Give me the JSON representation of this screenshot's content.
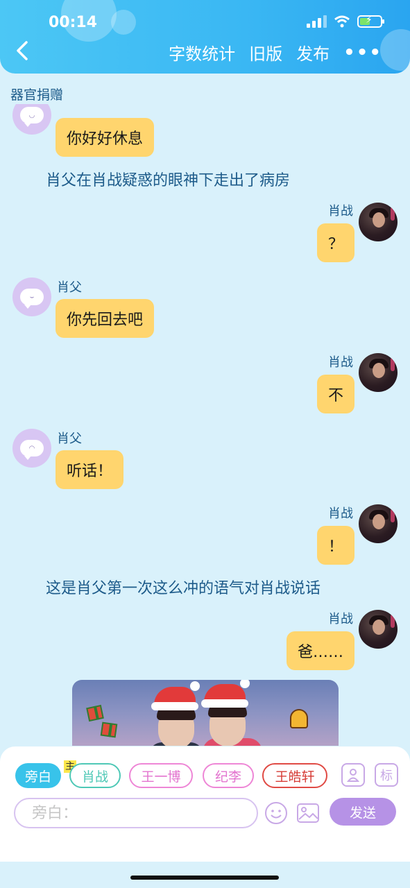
{
  "status": {
    "time": "00:14"
  },
  "header": {
    "back_icon": "chevron-left-icon",
    "actions": [
      "字数统计",
      "旧版",
      "发布"
    ],
    "more_label": "•••"
  },
  "subtitle": "器官捐赠",
  "colors": {
    "header": "#3ab7f3",
    "bubble": "#ffd56e",
    "text_blue": "#1d5b8a",
    "accent": "#38c3ea",
    "send": "#b692e6"
  },
  "chat": {
    "m1": {
      "text": "你好好休息"
    },
    "n1": "肖父在肖战疑惑的眼神下走出了病房",
    "m2": {
      "name": "肖战",
      "text": "？"
    },
    "m3": {
      "name": "肖父",
      "text": "你先回去吧"
    },
    "m4": {
      "name": "肖战",
      "text": "不"
    },
    "m5": {
      "name": "肖父",
      "text": "听话！"
    },
    "m6": {
      "name": "肖战",
      "text": "！"
    },
    "n2": "这是肖父第一次这么冲的语气对肖战说话",
    "m7": {
      "name": "肖战",
      "text": "爸……"
    }
  },
  "composer": {
    "roles": [
      "旁白",
      "肖战",
      "王一博",
      "纪李",
      "王皓轩"
    ],
    "host_badge": "主",
    "tag_button": "标",
    "input_placeholder": "旁白：",
    "send_label": "发送"
  }
}
